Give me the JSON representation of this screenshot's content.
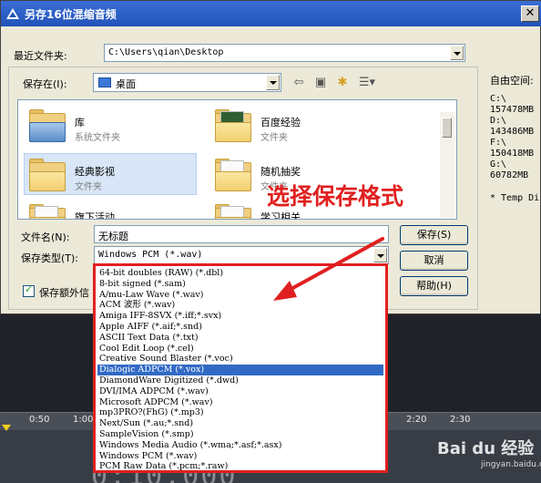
{
  "dialog": {
    "title": "另存16位混缩音频",
    "recent_label": "最近文件夹:",
    "recent_path": "C:\\Users\\qian\\Desktop",
    "save_in_label": "保存在(I):",
    "save_in_value": "桌面",
    "filename_label": "文件名(N):",
    "filename_value": "无标题",
    "filetype_label": "保存类型(T):",
    "filetype_value": "Windows PCM (*.wav)",
    "save_button": "保存(S)",
    "cancel_button": "取消",
    "help_button": "帮助(H)",
    "extra_checkbox_label": "保存额外信"
  },
  "files": [
    {
      "name": "库",
      "type": "系统文件夹"
    },
    {
      "name": "百度经验",
      "type": "文件夹"
    },
    {
      "name": "经典影视",
      "type": "文件夹"
    },
    {
      "name": "随机抽奖",
      "type": "文件夹"
    },
    {
      "name": "旗下活动",
      "type": ""
    },
    {
      "name": "学习相关",
      "type": ""
    }
  ],
  "free_space": {
    "label": "自由空间:",
    "drives": [
      {
        "drive": "C:\\",
        "size": "157478MB"
      },
      {
        "drive": "D:\\",
        "size": "143486MB"
      },
      {
        "drive": "F:\\",
        "size": "150418MB"
      },
      {
        "drive": "G:\\",
        "size": "60782MB"
      }
    ],
    "temp_note": "* Temp Di"
  },
  "file_types": [
    "64-bit doubles (RAW) (*.dbl)",
    "8-bit signed (*.sam)",
    "A/mu-Law Wave (*.wav)",
    "ACM 波形 (*.wav)",
    "Amiga IFF-8SVX (*.iff;*.svx)",
    "Apple AIFF (*.aif;*.snd)",
    "ASCII Text Data (*.txt)",
    "Cool Edit Loop (*.cel)",
    "Creative Sound Blaster (*.voc)",
    "Dialogic ADPCM (*.vox)",
    "DiamondWare Digitized (*.dwd)",
    "DVI/IMA ADPCM (*.wav)",
    "Microsoft ADPCM (*.wav)",
    "mp3PRO?(FhG) (*.mp3)",
    "Next/Sun (*.au;*.snd)",
    "SampleVision (*.smp)",
    "Windows Media Audio (*.wma;*.asf;*.asx)",
    "Windows PCM (*.wav)",
    "PCM Raw Data (*.pcm;*.raw)"
  ],
  "selected_file_type_index": 9,
  "annotation": "选择保存格式",
  "timeline": {
    "ticks": [
      "0:50",
      "1:00",
      "2:20",
      "2:30"
    ],
    "time_display": "0:10.000"
  },
  "watermark": {
    "text": "Bai du 经验",
    "sub": "jingyan.baidu.com"
  },
  "colors": {
    "titlebar": "#2152b8",
    "annotation": "#e02020",
    "selection": "#316ac5"
  }
}
